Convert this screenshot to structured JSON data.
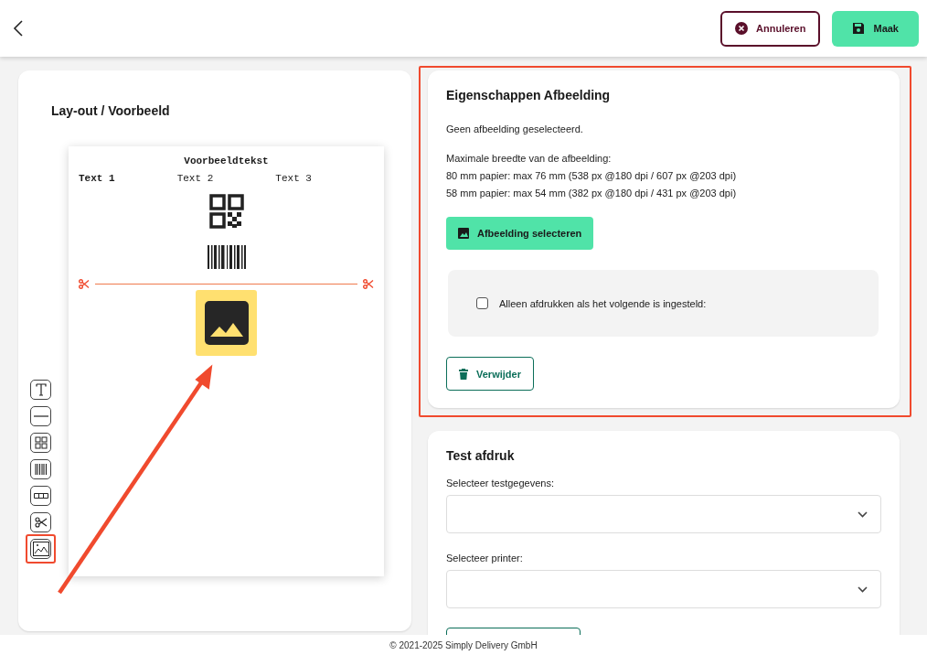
{
  "header": {
    "buttons": [
      {
        "label": "Annuleren",
        "kind": "cancel"
      },
      {
        "label": "Maak",
        "kind": "save"
      }
    ]
  },
  "layout": {
    "title": "Lay-out / Voorbeeld",
    "preview": {
      "heading": "Voorbeeldtekst",
      "columns": [
        {
          "text": "Text 1",
          "bold": true
        },
        {
          "text": "Text 2",
          "bold": false
        },
        {
          "text": "Text 3",
          "bold": false
        }
      ]
    },
    "tools": [
      {
        "kind": "text",
        "selected": false
      },
      {
        "kind": "line",
        "selected": false
      },
      {
        "kind": "qr",
        "selected": false
      },
      {
        "kind": "barcode",
        "selected": false
      },
      {
        "kind": "columns",
        "selected": false
      },
      {
        "kind": "cut",
        "selected": false
      },
      {
        "kind": "image",
        "selected": true
      }
    ]
  },
  "properties": {
    "highlighted": true,
    "title": "Eigenschappen Afbeelding",
    "status": "Geen afbeelding geselecteerd.",
    "info_lines": [
      "Maximale breedte van de afbeelding:",
      "80 mm papier: max 76 mm (538 px @180 dpi / 607 px @203 dpi)",
      "58 mm papier: max 54 mm (382 px @180 dpi / 431 px @203 dpi)"
    ],
    "select_button": "Afbeelding selecteren",
    "condition": {
      "label": "Alleen afdrukken als het volgende is ingesteld:",
      "checked": false
    },
    "delete_button": "Verwijder"
  },
  "test_print": {
    "title": "Test afdruk",
    "fields": [
      {
        "label": "Selecteer testgegevens:"
      },
      {
        "label": "Selecteer printer:"
      }
    ]
  },
  "footer": "© 2021-2025 Simply Delivery GmbH"
}
